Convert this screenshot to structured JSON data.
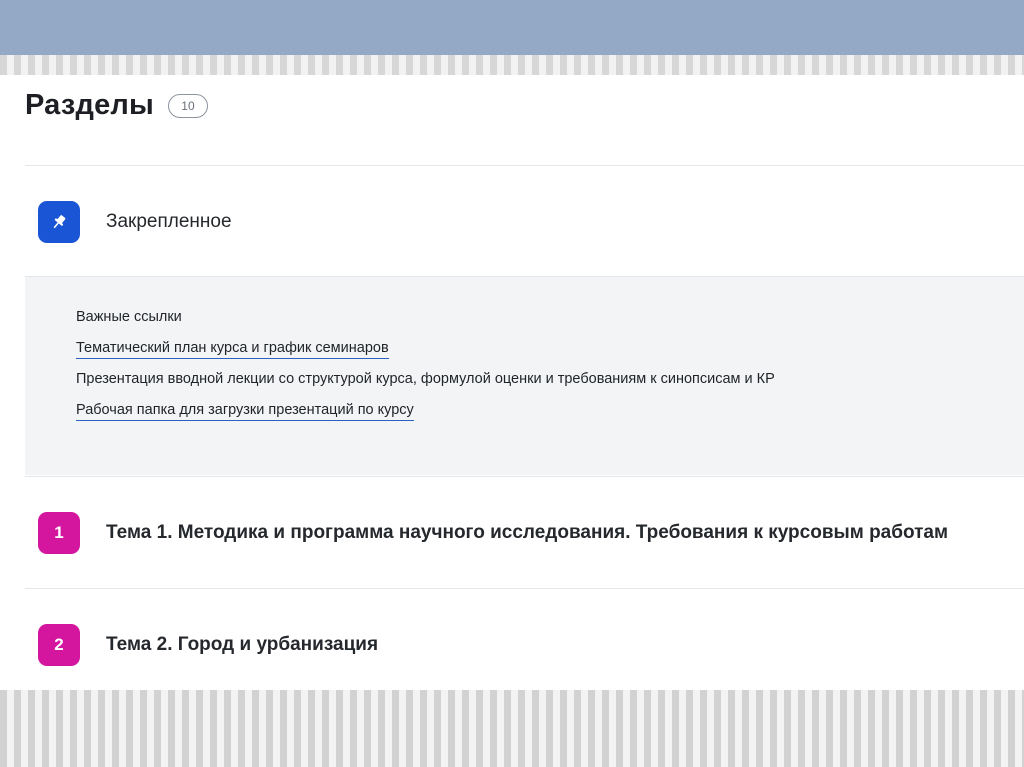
{
  "colors": {
    "top_band": "#93a9c6",
    "pinned_icon": "#1a55d6",
    "topic_icon": "#d4169e",
    "link_underline": "#2a5fc1"
  },
  "header": {
    "title": "Разделы",
    "count": "10"
  },
  "pinned": {
    "icon": "pin-icon",
    "title": "Закрепленное",
    "items": [
      {
        "text": "Важные ссылки",
        "is_link": false
      },
      {
        "text": "Тематический план курса и график семинаров",
        "is_link": true
      },
      {
        "text": "Презентация вводной лекции со структурой курса, формулой оценки и требованиям к синопсисам и КР",
        "is_link": false
      },
      {
        "text": "Рабочая папка для загрузки презентаций по курсу",
        "is_link": true
      }
    ]
  },
  "sections": [
    {
      "number": "1",
      "title": "Тема 1. Методика и программа научного исследования. Требования к курсовым работам"
    },
    {
      "number": "2",
      "title": "Тема 2. Город и урбанизация"
    }
  ]
}
